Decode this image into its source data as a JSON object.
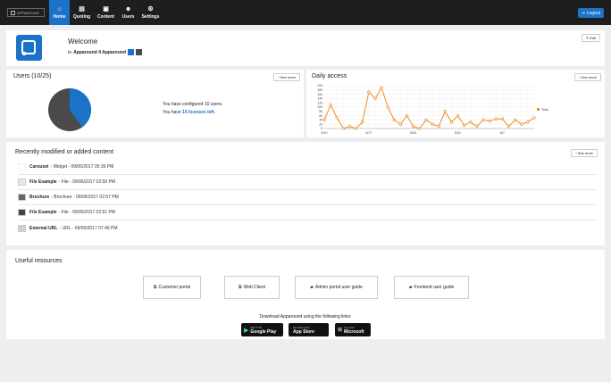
{
  "header": {
    "logo_text": "APPAROUND",
    "nav": [
      {
        "label": "Home",
        "icon": "home-icon",
        "active": true
      },
      {
        "label": "Quoting",
        "icon": "document-icon"
      },
      {
        "label": "Content",
        "icon": "content-icon"
      },
      {
        "label": "Users",
        "icon": "users-icon"
      },
      {
        "label": "Settings",
        "icon": "gear-icon"
      }
    ],
    "logout_label": "Logout"
  },
  "welcome": {
    "title": "Welcome",
    "subtitle_prefix": "to",
    "company": "Apparound 4 Apparound",
    "brand_colors": [
      "#1a73c8",
      "#4a4a4a"
    ],
    "edit_label": "Edit"
  },
  "users": {
    "title": "Users (10/25)",
    "see_more": "See more",
    "configured_text": "You have configured 10 users.",
    "licenses_prefix": "You have",
    "licenses_left": "15 licenses left.",
    "pie": {
      "used": 10,
      "total": 25,
      "used_color": "#1a73c8",
      "free_color": "#4a4a4a"
    }
  },
  "daily": {
    "title": "Daily access",
    "see_more": "See more",
    "chart_data": {
      "type": "line",
      "y_ticks": [
        "200",
        "180",
        "160",
        "140",
        "120",
        "100",
        "80",
        "60",
        "40",
        "20",
        "0"
      ],
      "x_ticks": [
        "5/10",
        "5/17",
        "5/24",
        "5/31",
        "6/7"
      ],
      "ylim": [
        0,
        200
      ],
      "series": [
        {
          "name": "Total",
          "color": "#f08c1e",
          "values": [
            40,
            110,
            50,
            0,
            10,
            0,
            30,
            170,
            140,
            190,
            100,
            40,
            20,
            60,
            10,
            0,
            40,
            20,
            10,
            80,
            30,
            60,
            15,
            30,
            10,
            40,
            35,
            45,
            45,
            10,
            40,
            20,
            30,
            50
          ]
        }
      ]
    }
  },
  "recent": {
    "title": "Recently modified or added content",
    "see_more": "See more",
    "items": [
      {
        "name": "Carousel",
        "meta": "- Widget - 09/06/2017 05:35 PM"
      },
      {
        "name": "File Example",
        "meta": "- File - 09/06/2017 02:59 PM"
      },
      {
        "name": "Brochure",
        "meta": "- Brochure - 09/06/2017 02:57 PM"
      },
      {
        "name": "File Example",
        "meta": "- File - 09/06/2017 02:51 PM"
      },
      {
        "name": "External URL",
        "meta": "- URL - 09/06/2017 07:46 PM"
      }
    ]
  },
  "resources": {
    "title": "Useful resources",
    "buttons": [
      {
        "label": "Customer portal",
        "icon": "external-link-icon"
      },
      {
        "label": "Web Client",
        "icon": "external-link-icon"
      },
      {
        "label": "Admin portal user guide",
        "icon": "book-icon"
      },
      {
        "label": "Frontend user guide",
        "icon": "book-icon"
      }
    ],
    "download_text": "Download Apparound using the following links:",
    "stores": [
      {
        "small": "GET IT ON",
        "large": "Google Play",
        "icon": "google-play-icon"
      },
      {
        "small": "Download on the",
        "large": "App Store",
        "icon": "apple-icon"
      },
      {
        "small": "Get it from",
        "large": "Microsoft",
        "icon": "windows-icon"
      }
    ]
  }
}
